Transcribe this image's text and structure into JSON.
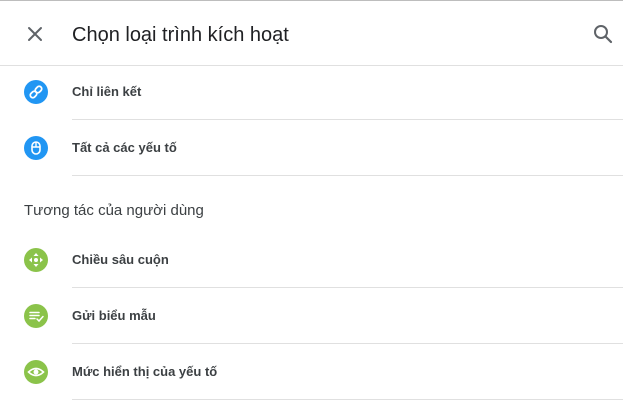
{
  "dialog": {
    "title": "Chọn loại trình kích hoạt"
  },
  "colors": {
    "blue_icon": "#2196f3",
    "green_icon": "#8bc34a"
  },
  "click_items": [
    {
      "label": "Chỉ liên kết",
      "icon": "link-icon"
    },
    {
      "label": "Tất cả các yếu tố",
      "icon": "mouse-icon"
    }
  ],
  "section": {
    "heading": "Tương tác của người dùng"
  },
  "user_items": [
    {
      "label": "Chiều sâu cuộn",
      "icon": "scroll-arrows-icon"
    },
    {
      "label": "Gửi biểu mẫu",
      "icon": "form-submit-icon"
    },
    {
      "label": "Mức hiển thị của yếu tố",
      "icon": "eye-icon"
    }
  ]
}
